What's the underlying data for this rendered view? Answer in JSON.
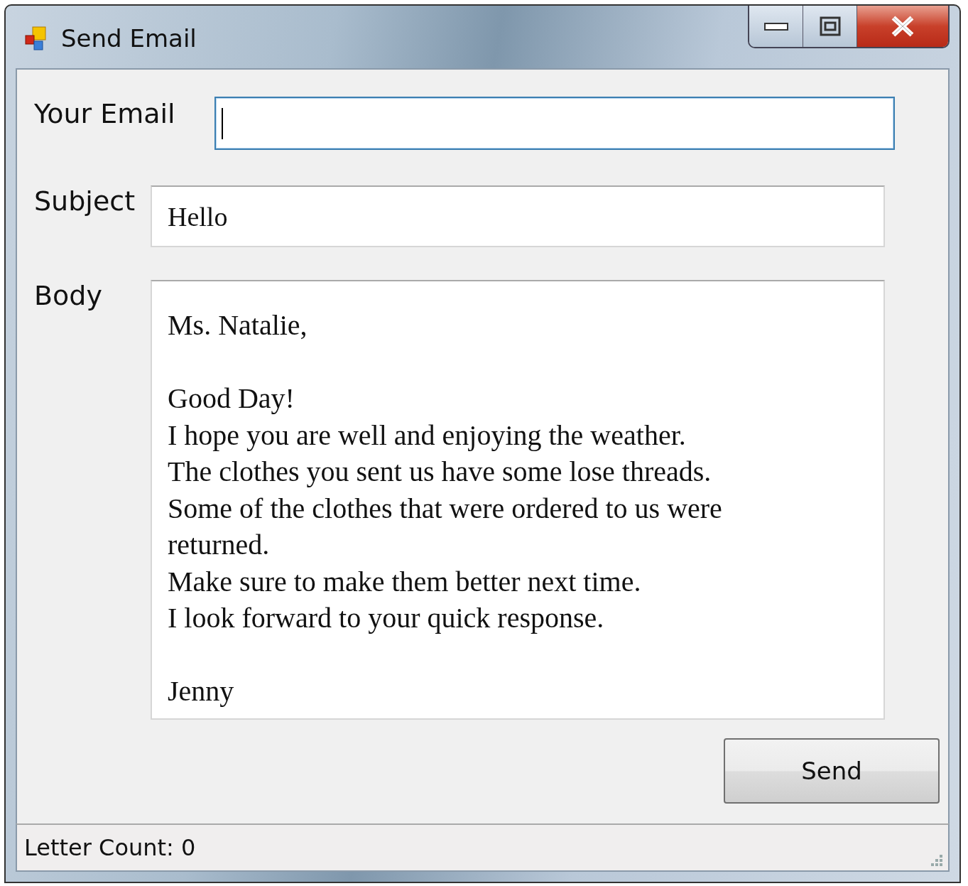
{
  "window": {
    "title": "Send Email"
  },
  "fields": [
    {
      "label": "Your Email",
      "focused": true
    },
    {
      "label": "Subject",
      "value": "Hello",
      "focused": false
    }
  ],
  "body": {
    "label": "Body",
    "value": "Ms. Natalie,\n\nGood Day!\nI hope you are well and enjoying the weather.\nThe clothes you sent us have some lose threads.\nSome of the clothes that were ordered to us were returned.\nMake sure to make them better next time.\nI look forward to your quick response.\n\nJenny"
  },
  "buttons": [
    {
      "label": "Send"
    }
  ],
  "status_bar": {
    "text": "Letter Count: 0"
  }
}
